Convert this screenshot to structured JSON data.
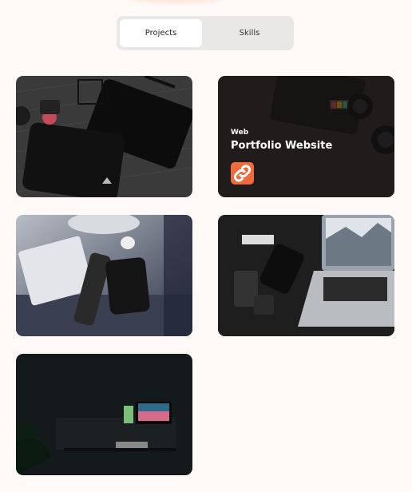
{
  "tabs": {
    "projects": "Projects",
    "skills": "Skills"
  },
  "projects": [
    {
      "id": 1
    },
    {
      "id": 2,
      "category": "Web",
      "title": "Portfolio Website"
    },
    {
      "id": 3
    },
    {
      "id": 4
    },
    {
      "id": 5
    }
  ],
  "colors": {
    "accent": "#f06a3e",
    "background": "#fffaf8",
    "tab_track": "#e9e8e6"
  }
}
